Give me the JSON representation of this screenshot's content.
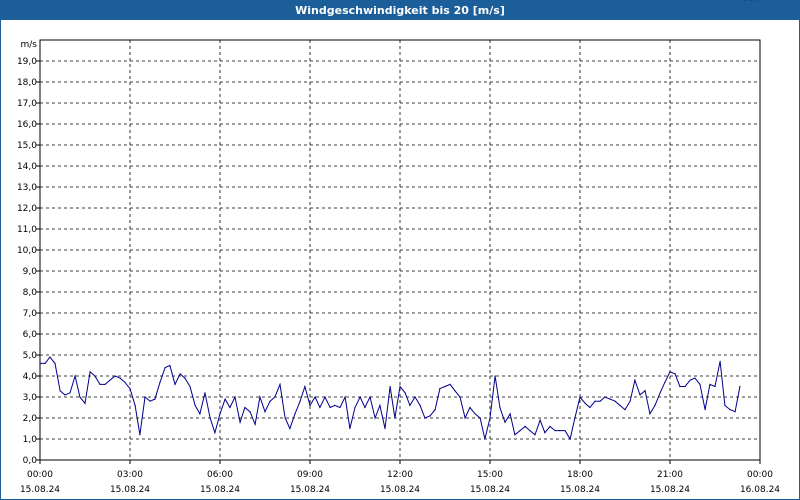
{
  "window": {
    "title": "Windgeschwindigkeit bis 20 [m/s]"
  },
  "chart_data": {
    "type": "line",
    "title": "Windgeschwindigkeit bis 20 [m/s]",
    "ylabel": "m/s",
    "ylim": [
      0,
      20
    ],
    "xlim_hours": [
      0,
      24
    ],
    "grid": true,
    "y_ticks": [
      "0,0",
      "1,0",
      "2,0",
      "3,0",
      "4,0",
      "5,0",
      "6,0",
      "7,0",
      "8,0",
      "9,0",
      "10,0",
      "11,0",
      "12,0",
      "13,0",
      "14,0",
      "15,0",
      "16,0",
      "17,0",
      "18,0",
      "19,0"
    ],
    "x_ticks": [
      {
        "time": "00:00",
        "date": "15.08.24"
      },
      {
        "time": "03:00",
        "date": "15.08.24"
      },
      {
        "time": "06:00",
        "date": "15.08.24"
      },
      {
        "time": "09:00",
        "date": "15.08.24"
      },
      {
        "time": "12:00",
        "date": "15.08.24"
      },
      {
        "time": "15:00",
        "date": "15.08.24"
      },
      {
        "time": "18:00",
        "date": "15.08.24"
      },
      {
        "time": "21:00",
        "date": "15.08.24"
      },
      {
        "time": "00:00",
        "date": "16.08.24"
      }
    ],
    "line_color": "#00008b",
    "series": [
      {
        "x_hours": [
          0,
          0.17,
          0.33,
          0.5,
          0.67,
          0.83,
          1,
          1.17,
          1.33,
          1.5,
          1.67,
          1.83,
          2,
          2.17,
          2.33,
          2.5,
          2.67,
          2.83,
          3,
          3.17,
          3.33,
          3.5,
          3.67,
          3.83,
          4,
          4.17,
          4.33,
          4.5,
          4.67,
          4.83,
          5,
          5.17,
          5.33,
          5.5,
          5.67,
          5.83,
          6,
          6.17,
          6.33,
          6.5,
          6.67,
          6.83,
          7,
          7.17,
          7.33,
          7.5,
          7.67,
          7.83,
          8,
          8.17,
          8.33,
          8.5,
          8.67,
          8.83,
          9,
          9.17,
          9.33,
          9.5,
          9.67,
          9.83,
          10,
          10.17,
          10.33,
          10.5,
          10.67,
          10.83,
          11,
          11.17,
          11.33,
          11.5,
          11.67,
          11.83,
          12,
          12.17,
          12.33,
          12.5,
          12.67,
          12.83,
          13,
          13.17,
          13.33,
          13.5,
          13.67,
          13.83,
          14,
          14.17,
          14.33,
          14.5,
          14.67,
          14.83,
          15,
          15.17,
          15.33,
          15.5,
          15.67,
          15.83,
          16,
          16.17,
          16.33,
          16.5,
          16.67,
          16.83,
          17,
          17.17,
          17.33,
          17.5,
          17.67,
          17.83,
          18,
          18.17,
          18.33,
          18.5,
          18.67,
          18.83,
          19,
          19.17,
          19.33,
          19.5,
          19.67,
          19.83,
          20,
          20.17,
          20.33,
          20.5,
          20.67,
          20.83,
          21,
          21.17,
          21.33,
          21.5,
          21.67,
          21.83,
          22,
          22.17,
          22.33,
          22.5,
          22.67,
          22.83,
          23,
          23.17,
          23.33,
          23.5,
          23.67,
          23.83
        ],
        "values": [
          4.6,
          4.6,
          4.9,
          4.6,
          3.3,
          3.1,
          3.2,
          4.0,
          3.0,
          2.7,
          4.2,
          4.0,
          3.6,
          3.6,
          3.8,
          4.0,
          3.9,
          3.7,
          3.4,
          2.6,
          1.2,
          3.0,
          2.8,
          2.9,
          3.7,
          4.4,
          4.5,
          3.6,
          4.1,
          3.9,
          3.5,
          2.6,
          2.2,
          3.2,
          2.0,
          1.3,
          2.2,
          2.9,
          2.5,
          3.0,
          1.8,
          2.5,
          2.3,
          1.7,
          3.0,
          2.3,
          2.8,
          3.0,
          3.6,
          2.0,
          1.5,
          2.2,
          2.8,
          3.5,
          2.6,
          3.0,
          2.5,
          3.0,
          2.5,
          2.6,
          2.5,
          3.0,
          1.5,
          2.5,
          3.0,
          2.5,
          3.0,
          2.0,
          2.6,
          1.5,
          3.5,
          2.0,
          3.5,
          3.2,
          2.6,
          3.0,
          2.6,
          2.0,
          2.1,
          2.4,
          3.4,
          3.5,
          3.6,
          3.3,
          3.0,
          2.0,
          2.5,
          2.2,
          2.0,
          1.0,
          2.0,
          4.0,
          2.5,
          1.8,
          2.2,
          1.2,
          1.4,
          1.6,
          1.4,
          1.2,
          1.9,
          1.3,
          1.6,
          1.4,
          1.4,
          1.4,
          1.0,
          2.0,
          3.0,
          2.7,
          2.5,
          2.8,
          2.8,
          3.0,
          2.9,
          2.8,
          2.6,
          2.4,
          2.8,
          3.8,
          3.1,
          3.3,
          2.2,
          2.6,
          3.2,
          3.7,
          4.2,
          4.1,
          3.5,
          3.5,
          3.8,
          3.9,
          3.6,
          2.4,
          3.6,
          3.5,
          4.7,
          2.6,
          2.4,
          2.3,
          3.5
        ]
      }
    ]
  }
}
